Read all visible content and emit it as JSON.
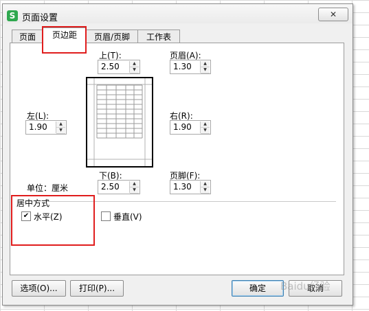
{
  "dialog": {
    "title": "页面设置",
    "icon_letter": "S",
    "icon_name": "wps-spreadsheet-icon",
    "close_icon": "close-icon",
    "close_glyph": "✕"
  },
  "tabs": [
    {
      "label": "页面",
      "active": false
    },
    {
      "label": "页边距",
      "active": true
    },
    {
      "label": "页眉/页脚",
      "active": false
    },
    {
      "label": "工作表",
      "active": false
    }
  ],
  "margins": {
    "top": {
      "label": "上(T):",
      "value": "2.50"
    },
    "header": {
      "label": "页眉(A):",
      "value": "1.30"
    },
    "left": {
      "label": "左(L):",
      "value": "1.90"
    },
    "right": {
      "label": "右(R):",
      "value": "1.90"
    },
    "bottom": {
      "label": "下(B):",
      "value": "2.50"
    },
    "footer": {
      "label": "页脚(F):",
      "value": "1.30"
    }
  },
  "unit_label": "单位：厘米",
  "centering": {
    "title": "居中方式",
    "horizontal": {
      "label": "水平(Z)",
      "checked": true
    },
    "vertical": {
      "label": "垂直(V)",
      "checked": false
    }
  },
  "buttons": {
    "options": "选项(O)...",
    "print": "打印(P)...",
    "ok": "确定",
    "cancel": "取消"
  },
  "watermark": "Baidu经验",
  "highlight_color": "#e01c1c"
}
